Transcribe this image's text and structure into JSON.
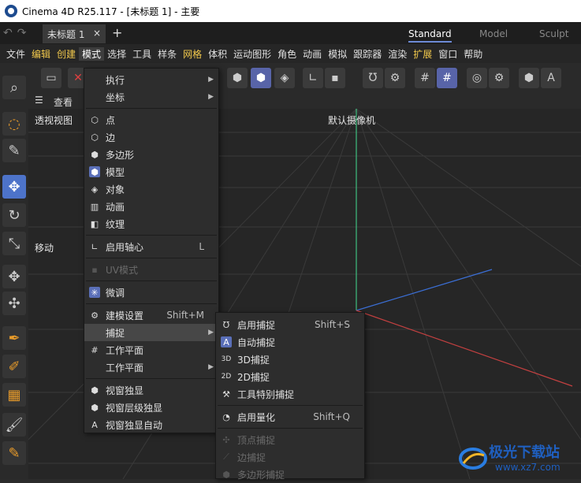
{
  "window": {
    "title": "Cinema 4D R25.117 - [未标题 1] - 主要"
  },
  "tabs": {
    "doc": "未标题 1",
    "close": "×",
    "add": "+"
  },
  "layouts": [
    "Standard",
    "Model",
    "Sculpt"
  ],
  "menubar": [
    "文件",
    "编辑",
    "创建",
    "模式",
    "选择",
    "工具",
    "样条",
    "网格",
    "体积",
    "运动图形",
    "角色",
    "动画",
    "模拟",
    "跟踪器",
    "渲染",
    "扩展",
    "窗口",
    "帮助"
  ],
  "viewport": {
    "menu": "查看",
    "view_name": "透视视图",
    "camera": "默认摄像机",
    "mode_label": "移动"
  },
  "mode_menu": {
    "items": [
      {
        "label": "执行",
        "icon": "none",
        "submenu": true
      },
      {
        "label": "坐标",
        "icon": "none",
        "submenu": true
      },
      {
        "label": "点",
        "icon": "point-mode-icon"
      },
      {
        "label": "边",
        "icon": "edge-mode-icon"
      },
      {
        "label": "多边形",
        "icon": "polygon-mode-icon"
      },
      {
        "label": "模型",
        "icon": "model-mode-icon",
        "selected": true
      },
      {
        "label": "对象",
        "icon": "object-mode-icon"
      },
      {
        "label": "动画",
        "icon": "animation-mode-icon"
      },
      {
        "label": "纹理",
        "icon": "texture-mode-icon"
      },
      {
        "label": "启用轴心",
        "icon": "axis-icon",
        "shortcut": "L"
      },
      {
        "label": "UV模式",
        "icon": "uv-icon",
        "disabled": true
      },
      {
        "label": "微调",
        "icon": "tweak-icon",
        "selected": true
      },
      {
        "label": "建模设置",
        "icon": "modeling-settings-icon",
        "shortcut": "Shift+M"
      },
      {
        "label": "捕捉",
        "icon": "none",
        "submenu": true,
        "highlighted": true
      },
      {
        "label": "工作平面",
        "icon": "workplane-icon"
      },
      {
        "label": "工作平面",
        "icon": "none",
        "submenu": true
      },
      {
        "label": "视窗独显",
        "icon": "solo-icon"
      },
      {
        "label": "视窗层级独显",
        "icon": "solo-hierarchy-icon"
      },
      {
        "label": "视窗独显自动",
        "icon": "solo-auto-icon"
      }
    ]
  },
  "snap_menu": {
    "items": [
      {
        "label": "启用捕捉",
        "icon": "magnet-icon",
        "shortcut": "Shift+S"
      },
      {
        "label": "自动捕捉",
        "icon": "auto-snap-icon",
        "selected": true
      },
      {
        "label": "3D捕捉",
        "icon": "snap-3d-icon"
      },
      {
        "label": "2D捕捉",
        "icon": "snap-2d-icon"
      },
      {
        "label": "工具特别捕捉",
        "icon": "tool-snap-icon"
      },
      {
        "label": "启用量化",
        "icon": "quantize-icon",
        "shortcut": "Shift+Q"
      },
      {
        "label": "顶点捕捉",
        "icon": "vertex-snap-icon",
        "disabled": true
      },
      {
        "label": "边捕捉",
        "icon": "edge-snap-icon",
        "disabled": true
      },
      {
        "label": "多边形捕捉",
        "icon": "polygon-snap-icon",
        "disabled": true
      }
    ]
  },
  "watermark": {
    "text": "极光下载站",
    "url": "www.xz7.com"
  },
  "colors": {
    "accent": "#5864a8",
    "menu_bg": "#2d2d2d",
    "axis_y": "#3fbf7f",
    "axis_x": "#c44040",
    "axis_z": "#3b6fd6"
  }
}
